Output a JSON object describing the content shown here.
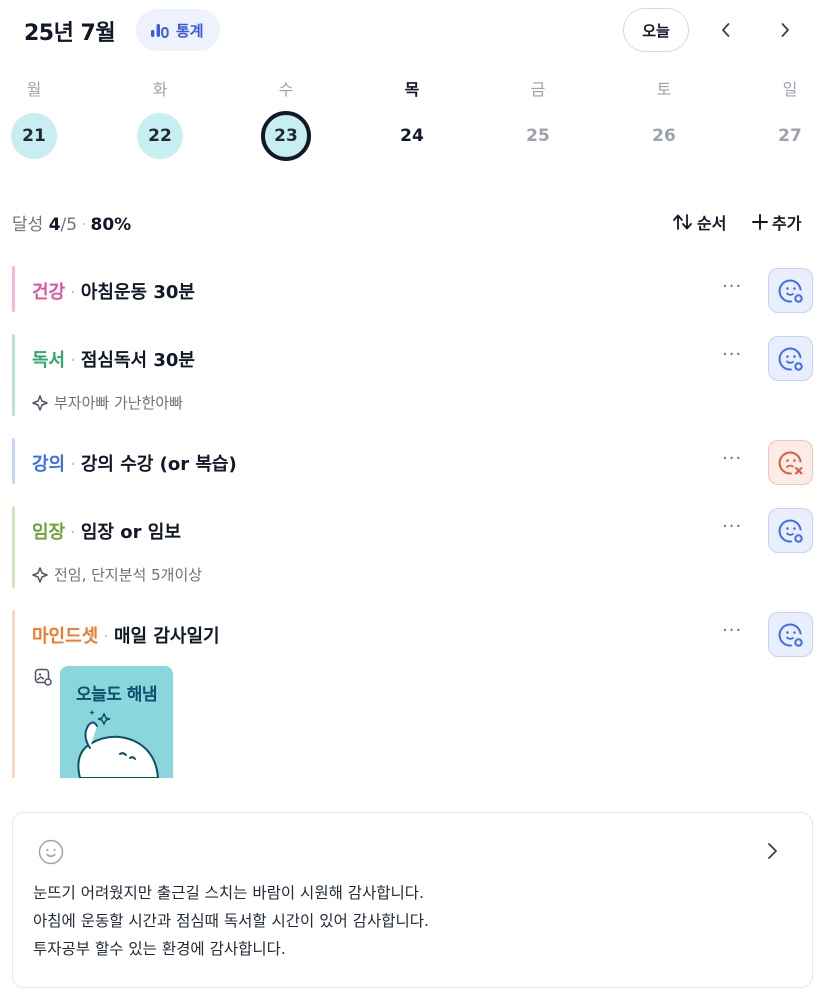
{
  "header": {
    "month_title": "25년 7월",
    "stats_label": "통계",
    "today_label": "오늘",
    "accent": "#3b5bdb"
  },
  "week": {
    "days": [
      "월",
      "화",
      "수",
      "목",
      "금",
      "토",
      "일"
    ],
    "dates": [
      "21",
      "22",
      "23",
      "24",
      "25",
      "26",
      "27"
    ],
    "selected_index": 2,
    "today_index": 3
  },
  "summary": {
    "label": "달성",
    "count": "4",
    "total": "/5",
    "percent": "80%",
    "order_label": "순서",
    "add_label": "추가"
  },
  "habits": [
    {
      "category": "건강",
      "name": "아침운동 30분",
      "color": "#e0529c",
      "bar": "#f4b9d8",
      "status": "success",
      "memo": ""
    },
    {
      "category": "독서",
      "name": "점심독서 30분",
      "color": "#2fa86b",
      "bar": "#b9e6cf",
      "status": "success",
      "memo": "부자아빠 가난한아빠"
    },
    {
      "category": "강의",
      "name": "강의 수강 (or 복습)",
      "color": "#3b6ef0",
      "bar": "#c6d5fa",
      "status": "fail",
      "memo": ""
    },
    {
      "category": "임장",
      "name": "임장 or 임보",
      "color": "#6aa53a",
      "bar": "#cfe7b8",
      "status": "success",
      "memo": "전임, 단지분석 5개이상"
    },
    {
      "category": "마인드셋",
      "name": "매일 감사일기",
      "color": "#f07a28",
      "bar": "#fad7bd",
      "status": "success",
      "memo": ""
    }
  ],
  "sticker": {
    "text": "오늘도 해냄"
  },
  "diary": {
    "lines": [
      "눈뜨기 어려웠지만 출근길 스치는 바람이 시원해 감사합니다.",
      "아침에 운동할 시간과 점심때 독서할 시간이 있어 감사합니다.",
      "투자공부 할수 있는 환경에 감사합니다."
    ]
  }
}
